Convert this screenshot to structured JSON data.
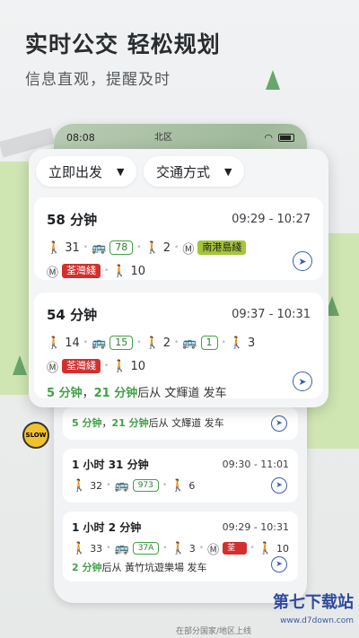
{
  "hero": {
    "title": "实时公交 轻松规划",
    "subtitle": "信息直观，提醒及时"
  },
  "phone": {
    "time": "08:08",
    "map_label": "北区"
  },
  "filters": {
    "depart": "立即出发",
    "mode": "交通方式"
  },
  "cards": [
    {
      "duration": "58 分钟",
      "time": "09:29 - 10:27",
      "walk1": "31",
      "bus": "78",
      "walk2": "2",
      "line": "南港島綫",
      "line2": "荃灣綫",
      "walk3": "10"
    },
    {
      "duration": "54 分钟",
      "time": "09:37 - 10:31",
      "walk1": "14",
      "bus": "15",
      "walk2": "2",
      "bus2": "1",
      "walk3": "3",
      "line": "荃灣綫",
      "walk4": "10",
      "depart_a": "5 分钟",
      "sep": "，",
      "depart_b": "21 分钟",
      "depart_c": "后从 文輝道 发车"
    }
  ],
  "small": [
    {
      "depart_a": "5 分钟",
      "sep": "，",
      "depart_b": "21 分钟",
      "depart_c": "后从 文輝道 发车"
    },
    {
      "duration": "1 小时 31 分钟",
      "time": "09:30 - 11:01",
      "walk1": "32",
      "bus": "973",
      "walk2": "6"
    },
    {
      "duration": "1 小时 2 分钟",
      "time": "09:29 - 10:31",
      "walk1": "33",
      "bus": "37A",
      "walk2": "3",
      "line": "荃灣綫",
      "walk3": "10",
      "depart_a": "2 分钟",
      "depart_c": "后从 黃竹坑遊樂場 发车"
    }
  ],
  "watermark": {
    "brand": "第七下载站",
    "url": "www.d7down.com",
    "note": "在部分国家/地区上线"
  },
  "sign": "SLOW"
}
